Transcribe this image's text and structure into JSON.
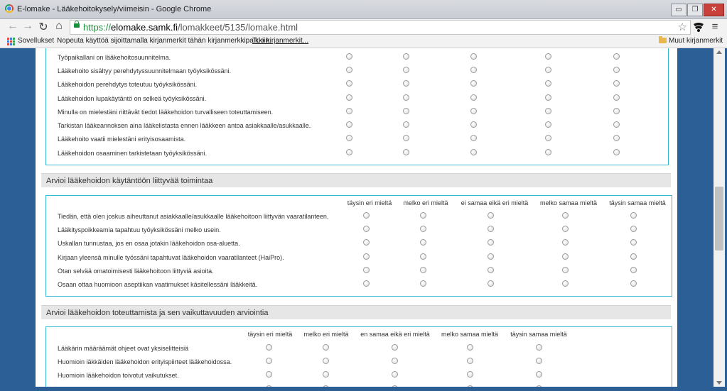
{
  "window": {
    "title": "E-lomake - Lääkehoitokysely/viimeisin - Google Chrome",
    "minimize": "▭",
    "restore": "❐",
    "close": "✕"
  },
  "browser": {
    "back": "←",
    "forward": "→",
    "reload": "↻",
    "home": "⌂",
    "url_scheme": "https://",
    "url_host": "elomake.samk.fi",
    "url_path": "/lomakkeet/5135/lomake.html",
    "star": "☆",
    "menu": "≡"
  },
  "bookmarks": {
    "apps": "Sovellukset",
    "hint": "Nopeuta käyttöä sijoittamalla kirjanmerkit tähän kirjanmerkkipalkkiin.",
    "import_link": "Tuo kirjanmerkit...",
    "other": "Muut kirjanmerkit"
  },
  "block1": {
    "questions": [
      "Työpaikallani on lääkehoitosuunnitelma.",
      "Lääkehoito sisältyy perehdytyssuunnitelmaan työyksikössäni.",
      "Lääkehoidon perehdytys toteutuu työyksikössäni.",
      "Lääkehoidon lupakäytäntö on selkeä työyksikössäni.",
      "Minulla on mielestäni riittävät tiedot lääkehoidon turvalliseen toteuttamiseen.",
      "Tarkistan lääkeannoksen aina lääkelistasta ennen lääkkeen antoa asiakkaalle/asukkaalle.",
      "Lääkehoito vaatii mielestäni erityisosaamista.",
      "Lääkehoidon osaaminen tarkistetaan työyksikössäni."
    ]
  },
  "section2": {
    "title": "Arvioi lääkehoidon käytäntöön liittyvää toimintaa",
    "columns": [
      "täysin eri mieltä",
      "melko eri mieltä",
      "ei samaa eikä eri mieltä",
      "melko samaa mieltä",
      "täysin samaa mieltä"
    ],
    "questions": [
      "Tiedän, että olen joskus aiheuttanut asiakkaalle/asukkaalle lääkehoitoon liittyvän vaaratilanteen.",
      "Lääkityspoikkeamia tapahtuu työyksikössäni melko usein.",
      "Uskallan tunnustaa, jos en osaa jotakin lääkehoidon osa-aluetta.",
      "Kirjaan yleensä minulle työssäni tapahtuvat lääkehoidon vaaratilanteet (HaiPro).",
      "Otan selvää omatoimisesti lääkehoitoon liittyviä asioita.",
      "Osaan ottaa huomioon aseptiikan vaatimukset käsitellessäni lääkkeitä."
    ]
  },
  "section3": {
    "title": "Arvioi lääkehoidon toteuttamista ja sen vaikuttavuuden arviointia",
    "columns": [
      "täysin eri mieltä",
      "melko eri mieltä",
      "en samaa eikä eri mieltä",
      "melko samaa mieltä",
      "täysin samaa mieltä"
    ],
    "questions": [
      "Lääkärin määräämät ohjeet ovat yksiselitteisiä",
      "Huomioin iäkkäiden lääkehoidon erityispiirteet lääkehoidossa.",
      "Huomioin lääkehoidon toivotut vaikutukset."
    ]
  }
}
